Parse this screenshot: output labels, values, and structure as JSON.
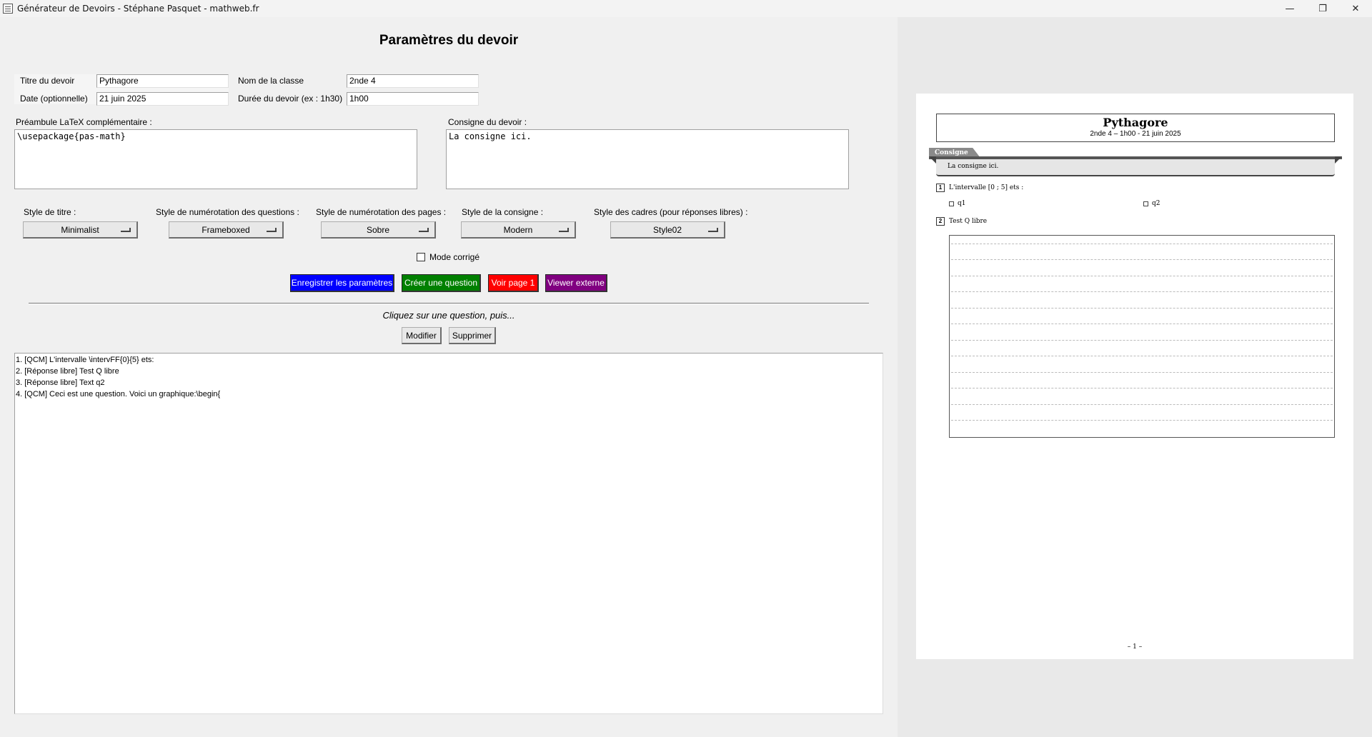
{
  "window": {
    "title": "Générateur de Devoirs - Stéphane Pasquet - mathweb.fr",
    "minimize_glyph": "—",
    "maximize_glyph": "❐",
    "close_glyph": "✕"
  },
  "form": {
    "heading": "Paramètres du devoir",
    "title_label": "Titre du devoir",
    "title_value": "Pythagore",
    "class_label": "Nom de la classe",
    "class_value": "2nde 4",
    "date_label": "Date (optionnelle)",
    "date_value": "21 juin 2025",
    "duration_label": "Durée du devoir (ex : 1h30)",
    "duration_value": "1h00",
    "preamble_label": "Préambule LaTeX complémentaire :",
    "preamble_value": "\\usepackage{pas-math}",
    "consigne_label": "Consigne du devoir :",
    "consigne_value": "La consigne ici."
  },
  "styles": {
    "title_style_label": "Style de titre :",
    "title_style_value": "Minimalist",
    "question_num_label": "Style de numérotation des questions :",
    "question_num_value": "Frameboxed",
    "page_num_label": "Style de numérotation des pages :",
    "page_num_value": "Sobre",
    "consigne_style_label": "Style de la consigne :",
    "consigne_style_value": "Modern",
    "frame_style_label": "Style des cadres (pour réponses libres) :",
    "frame_style_value": "Style02"
  },
  "mode_corrige_label": "Mode corrigé",
  "actions": {
    "save": "Enregistrer les paramètres",
    "create": "Créer une question",
    "view_page": "Voir page 1",
    "external_viewer": "Viewer externe",
    "save_color": "#0000ff",
    "create_color": "#008000",
    "view_color": "#ff0000",
    "external_color": "#800080"
  },
  "questions": {
    "hint": "Cliquez sur une question, puis...",
    "edit": "Modifier",
    "delete": "Supprimer",
    "items": [
      "1. [QCM] L'intervalle \\intervFF{0}{5} ets:",
      "2. [Réponse libre] Test Q libre",
      "3. [Réponse libre] Text q2",
      "4. [QCM] Ceci est une question. Voici un graphique:\\begin{"
    ]
  },
  "preview": {
    "title": "Pythagore",
    "subtitle": "2nde 4 – 1h00 - 21 juin 2025",
    "consigne_tab": "Consigne",
    "consigne_text": "La consigne ici.",
    "q1_num": "1",
    "q1_text": "L'intervalle [0 ; 5] ets :",
    "q1_choice_a": "q1",
    "q1_choice_b": "q2",
    "q2_num": "2",
    "q2_text": "Test Q libre",
    "page_number": "– 1 –"
  }
}
